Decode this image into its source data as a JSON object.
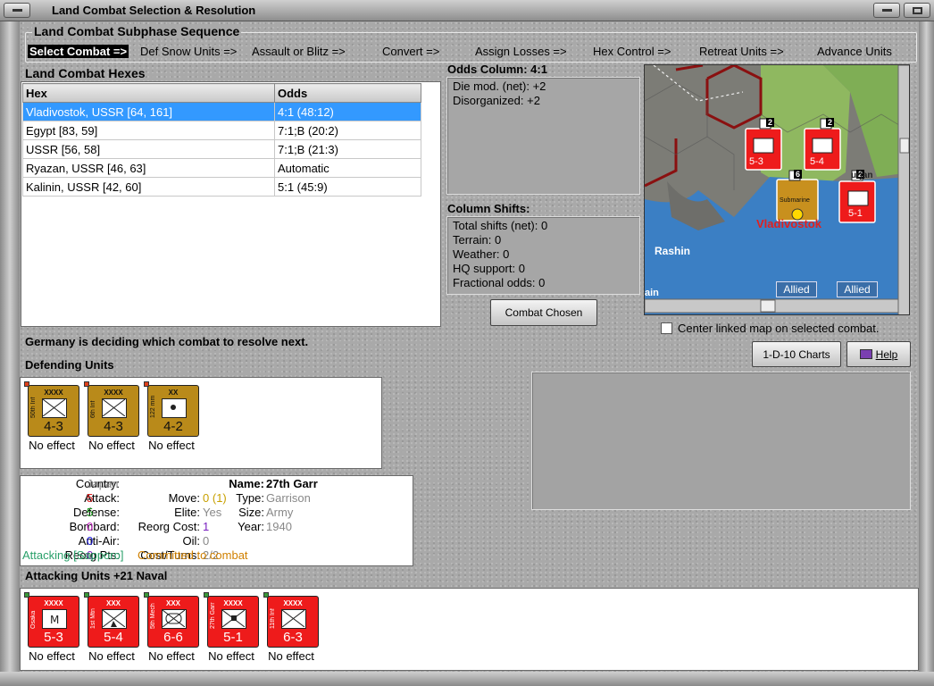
{
  "window": {
    "title": "Land Combat Selection & Resolution"
  },
  "subphase": {
    "title": "Land Combat Subphase Sequence",
    "steps": [
      "Select Combat =>",
      "Def Snow Units =>",
      "Assault or Blitz =>",
      "Convert =>",
      "Assign Losses =>",
      "Hex Control =>",
      "Retreat Units =>",
      "Advance Units"
    ]
  },
  "hexes": {
    "title": "Land Combat Hexes",
    "columns": [
      "Hex",
      "Odds"
    ],
    "rows": [
      {
        "hex": "Vladivostok, USSR [64, 161]",
        "odds": "4:1 (48:12)"
      },
      {
        "hex": "Egypt [83, 59]",
        "odds": "7:1;B (20:2)"
      },
      {
        "hex": "USSR [56, 58]",
        "odds": "7:1;B (21:3)"
      },
      {
        "hex": "Ryazan, USSR [46, 63]",
        "odds": "Automatic"
      },
      {
        "hex": "Kalinin, USSR [42, 60]",
        "odds": "5:1 (45:9)"
      }
    ]
  },
  "odds": {
    "title": "Odds Column: 4:1",
    "lines": [
      "Die mod. (net): +2",
      "Disorganized: +2"
    ]
  },
  "shifts": {
    "title": "Column Shifts:",
    "lines": [
      "Total shifts (net): 0",
      "Terrain: 0",
      "Weather: 0",
      "HQ support: 0",
      "Fractional odds: 0"
    ]
  },
  "buttons": {
    "combat_chosen": "Combat Chosen",
    "charts": "1-D-10 Charts",
    "help": "Help"
  },
  "center_map": {
    "label": "Center linked map on selected combat.",
    "checked": false
  },
  "status": "Germany is deciding which combat to resolve next.",
  "defending": {
    "title": "Defending Units",
    "units": [
      {
        "name": "50th Inf",
        "size": "XXXX",
        "strength": "4-3",
        "effect": "No effect",
        "color": "#b98a1a"
      },
      {
        "name": "6th Inf",
        "size": "XXXX",
        "strength": "4-3",
        "effect": "No effect",
        "color": "#b98a1a"
      },
      {
        "name": "122 mm",
        "size": "XX",
        "strength": "4-2",
        "effect": "No effect",
        "color": "#b98a1a"
      }
    ]
  },
  "details": {
    "country_label": "Country:",
    "country": "Japan",
    "attack_label": "Attack:",
    "attack": "5",
    "defense_label": "Defense:",
    "defense": "5",
    "bombard_label": "Bombard:",
    "bombard": "0",
    "antiair_label": "Anti-Air:",
    "antiair": "0",
    "reorg_pts_label": "Reorg Pts:",
    "reorg_pts": "0",
    "name_label": "Name:",
    "name": "27th Garr",
    "move_label": "Move:",
    "move": "0",
    "move_extra": "(1)",
    "elite_label": "Elite:",
    "elite": "Yes",
    "reorg_cost_label": "Reorg Cost:",
    "reorg_cost": "1",
    "oil_label": "Oil:",
    "oil": "0",
    "cost_turns_label": "Cost/Turns:",
    "cost_turns": "2/2",
    "type_label": "Type:",
    "type": "Garrison",
    "size_label": "Size:",
    "size": "Army",
    "year_label": "Year:",
    "year": "1940",
    "attacking_note": "Attacking [Sapporo]",
    "committed_note": "Committed to combat"
  },
  "attacking": {
    "title": "Attacking Units +21 Naval",
    "units": [
      {
        "name": "Osaka",
        "size": "XXXX",
        "strength": "5-3",
        "effect": "No effect"
      },
      {
        "name": "1st Mtn",
        "size": "XXX",
        "strength": "5-4",
        "effect": "No effect"
      },
      {
        "name": "5th Mech",
        "size": "XXX",
        "strength": "6-6",
        "effect": "No effect"
      },
      {
        "name": "27th Garr",
        "size": "XXXX",
        "strength": "5-1",
        "effect": "No effect"
      },
      {
        "name": "11th Inf",
        "size": "XXXX",
        "strength": "6-3",
        "effect": "No effect"
      }
    ]
  },
  "map": {
    "labels": {
      "city": "Vladivostok",
      "rashin": "Rashin",
      "allied1": "Allied",
      "allied2": "Allied",
      "ain": "ain",
      "turjan": "urjan"
    },
    "stacks": [
      {
        "count": "2",
        "strength": "5-3"
      },
      {
        "count": "2",
        "strength": "5-4"
      },
      {
        "count": "6",
        "strength": "Submarine"
      },
      {
        "count": "2",
        "strength": "5-1"
      }
    ]
  },
  "colors": {
    "red_unit": "#ee1b1b",
    "brown_unit": "#b98a1a",
    "select": "#3399ff",
    "sea": "#3b7fc4"
  }
}
